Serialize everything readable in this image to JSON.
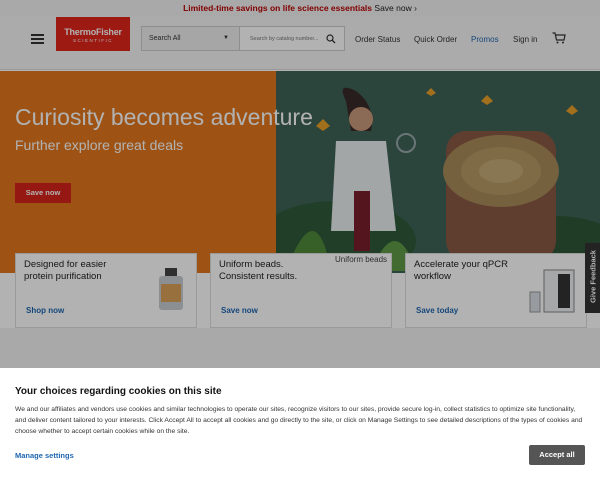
{
  "promo": {
    "text": "Limited-time savings on life science essentials",
    "link": "Save now ›"
  },
  "header": {
    "logo_line1": "ThermoFisher",
    "logo_line2": "SCIENTIFIC",
    "search_scope": "Search All",
    "search_placeholder": "Search by catalog number...",
    "nav": [
      "Order Status",
      "Quick Order",
      "Promos",
      "Sign in"
    ],
    "promos_color": "#1f66b0"
  },
  "hero": {
    "title": "Curiosity becomes adventure",
    "subtitle": "Further explore great deals",
    "button": "Save now"
  },
  "cards": [
    {
      "title": "Designed for easier protein purification",
      "link": "Shop now",
      "image": "bottle-image"
    },
    {
      "title": "Uniform beads. Consistent results.",
      "link": "Save now",
      "image_alt": "Uniform beads"
    },
    {
      "title": "Accelerate your qPCR workflow",
      "link": "Save today",
      "image": "kit-box-image"
    }
  ],
  "feedback": "Give Feedback",
  "cookie": {
    "title": "Your choices regarding cookies on this site",
    "body": "We and our affiliates and vendors use cookies and similar technologies to operate our sites, recognize visitors to our sites, provide secure log-in, collect statistics to optimize site functionality, and deliver content tailored to your interests. Click Accept All to accept all cookies and go directly to the site, or click on Manage Settings to see detailed descriptions of the types of cookies and choose whether to accept certain cookies while on the site.",
    "manage": "Manage settings",
    "accept": "Accept all"
  }
}
